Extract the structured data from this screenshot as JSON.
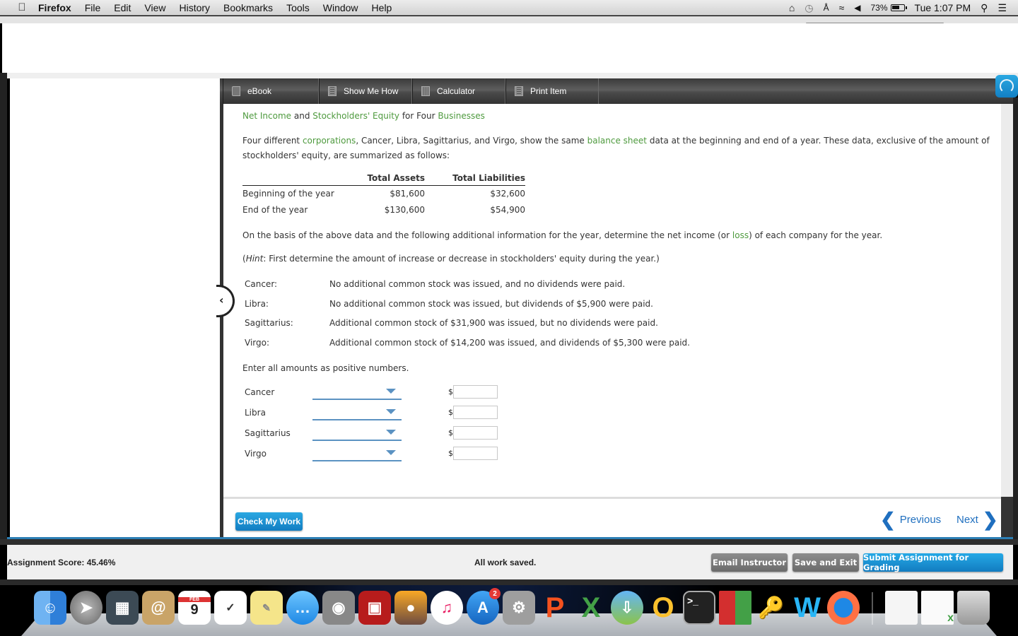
{
  "menubar": {
    "app_name": "Firefox",
    "items": [
      "File",
      "Edit",
      "View",
      "History",
      "Bookmarks",
      "Tools",
      "Window",
      "Help"
    ],
    "status": {
      "battery": "73%",
      "clock": "Tue 1:07 PM"
    },
    "icons": [
      "apple-logo-icon",
      "home-sharing-icon",
      "time-machine-icon",
      "bluetooth-icon",
      "wifi-icon",
      "volume-icon",
      "battery-icon",
      "spotlight-icon",
      "notification-center-icon"
    ]
  },
  "toolbar": {
    "buttons": [
      {
        "label": "eBook",
        "icon": "book-icon"
      },
      {
        "label": "Show Me How",
        "icon": "document-icon"
      },
      {
        "label": "Calculator",
        "icon": "calculator-icon"
      },
      {
        "label": "Print Item",
        "icon": "print-document-icon"
      }
    ]
  },
  "question": {
    "title": {
      "part1": "Net Income",
      "part2": " and ",
      "part3": "Stockholders' Equity",
      "part4": " for Four ",
      "part5": "Businesses"
    },
    "intro": {
      "a": "Four different ",
      "b": "corporations",
      "c": ", Cancer, Libra, Sagittarius, and Virgo, show the same ",
      "d": "balance sheet",
      "e": " data at the beginning and end of a year. These data, exclusive of the amount of stockholders' equity, are summarized as follows:"
    },
    "balance_table": {
      "headers": [
        "",
        "Total Assets",
        "Total Liabilities"
      ],
      "rows": [
        {
          "label": "Beginning of the year",
          "assets": "$81,600",
          "liabilities": "$32,600"
        },
        {
          "label": "End of the year",
          "assets": "$130,600",
          "liabilities": "$54,900"
        }
      ]
    },
    "instruction": {
      "a": "On the basis of the above data and the following additional information for the year, determine the net income (or ",
      "b": "loss",
      "c": ") of each company for the year."
    },
    "hint": {
      "label": "Hint",
      "open": "(",
      "text": ": First determine the amount of increase or decrease in stockholders' equity during the year.)"
    },
    "companies_info": [
      {
        "name": "Cancer:",
        "detail": "No additional common stock was issued, and no dividends were paid."
      },
      {
        "name": "Libra:",
        "detail": "No additional common stock was issued, but dividends of $5,900 were paid."
      },
      {
        "name": "Sagittarius:",
        "detail": "Additional common stock of $31,900 was issued, but no dividends were paid."
      },
      {
        "name": "Virgo:",
        "detail": "Additional common stock of $14,200 was issued, and dividends of $5,300 were paid."
      }
    ],
    "entry_note": "Enter all amounts as positive numbers.",
    "answers": [
      {
        "company": "Cancer",
        "dropdown_value": "",
        "currency": "$",
        "amount": ""
      },
      {
        "company": "Libra",
        "dropdown_value": "",
        "currency": "$",
        "amount": ""
      },
      {
        "company": "Sagittarius",
        "dropdown_value": "",
        "currency": "$",
        "amount": ""
      },
      {
        "company": "Virgo",
        "dropdown_value": "",
        "currency": "$",
        "amount": ""
      }
    ]
  },
  "footer": {
    "check_label": "Check My Work",
    "previous_label": "Previous",
    "next_label": "Next"
  },
  "status_bar": {
    "score": "Assignment Score: 45.46%",
    "saved": "All work saved.",
    "email_label": "Email Instructor",
    "save_exit_label": "Save and Exit",
    "submit_label": "Submit Assignment for Grading"
  },
  "dock": {
    "apps": [
      "Finder",
      "Launchpad",
      "Mission Control",
      "Contacts",
      "Calendar",
      "Reminders",
      "Notes",
      "Messages",
      "FaceTime",
      "Photo Booth",
      "iPhoto",
      "iTunes",
      "App Store",
      "System Preferences",
      "PowerPoint",
      "Excel",
      "Transmit",
      "Outlook",
      "Terminal",
      "CrossOver",
      "Keychain Access",
      "Word",
      "Firefox",
      "Document",
      "Spreadsheet",
      "Trash"
    ],
    "calendar_month": "FEB",
    "calendar_day": "9",
    "app_store_badge": "2"
  },
  "colors": {
    "link_green": "#4e9a3e",
    "accent_blue": "#1f8fd6",
    "nav_blue": "#1f6fbf"
  }
}
